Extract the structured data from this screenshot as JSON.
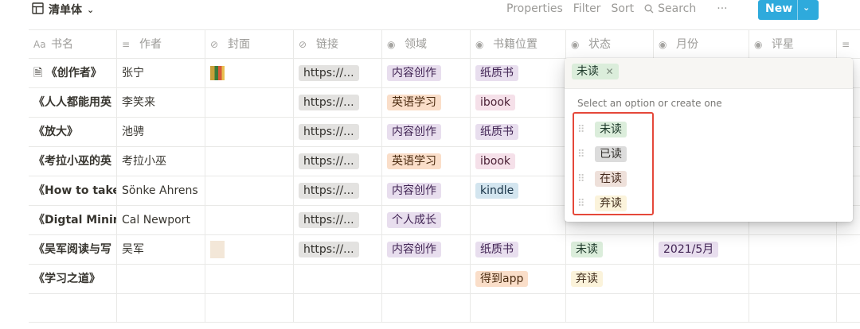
{
  "view": {
    "name": "清单体",
    "icon": "table-icon"
  },
  "toolbar": {
    "properties": "Properties",
    "filter": "Filter",
    "sort": "Sort",
    "search": "Search",
    "more": "···",
    "new": "New"
  },
  "columns": [
    {
      "label": "书名",
      "icon": "title-icon"
    },
    {
      "label": "作者",
      "icon": "text-icon"
    },
    {
      "label": "封面",
      "icon": "attachment-icon"
    },
    {
      "label": "链接",
      "icon": "link-icon"
    },
    {
      "label": "领域",
      "icon": "select-icon"
    },
    {
      "label": "书籍位置",
      "icon": "select-icon"
    },
    {
      "label": "状态",
      "icon": "select-icon"
    },
    {
      "label": "月份",
      "icon": "select-icon"
    },
    {
      "label": "评星",
      "icon": "select-icon"
    },
    {
      "label": "",
      "icon": "text-icon"
    }
  ],
  "rows": [
    {
      "title": "《创作者》",
      "author": "张宁",
      "cover": true,
      "link": "https://...",
      "domain": "内容创作",
      "location": "纸质书",
      "status": "",
      "month": ""
    },
    {
      "title": "《人人都能用英",
      "author": "李笑来",
      "cover": false,
      "link": "https://...",
      "domain": "英语学习",
      "location": "ibook",
      "status": "",
      "month": ""
    },
    {
      "title": "《放大》",
      "author": "池骋",
      "cover": false,
      "link": "https://...",
      "domain": "内容创作",
      "location": "纸质书",
      "status": "",
      "month": ""
    },
    {
      "title": "《考拉小巫的英",
      "author": "考拉小巫",
      "cover": false,
      "link": "https://...",
      "domain": "英语学习",
      "location": "ibook",
      "status": "",
      "month": ""
    },
    {
      "title": "《How to take",
      "author": "Sönke Ahrens",
      "cover": false,
      "link": "https://...",
      "domain": "内容创作",
      "location": "kindle",
      "status": "",
      "month": ""
    },
    {
      "title": "《Digtal Minim",
      "author": "Cal Newport",
      "cover": false,
      "link": "https://...",
      "domain": "个人成长",
      "location": "",
      "status": "",
      "month": ""
    },
    {
      "title": "《吴军阅读与写",
      "author": "吴军",
      "cover": true,
      "link": "https://...",
      "domain": "内容创作",
      "location": "纸质书",
      "status": "未读",
      "month": "2021/5月"
    },
    {
      "title": "《学习之道》",
      "author": "",
      "cover": false,
      "link": "",
      "domain": "",
      "location": "得到app",
      "status": "弃读",
      "month": ""
    }
  ],
  "popup": {
    "selected": "未读",
    "hint": "Select an option or create one",
    "options": [
      "未读",
      "已读",
      "在读",
      "弃读"
    ]
  }
}
